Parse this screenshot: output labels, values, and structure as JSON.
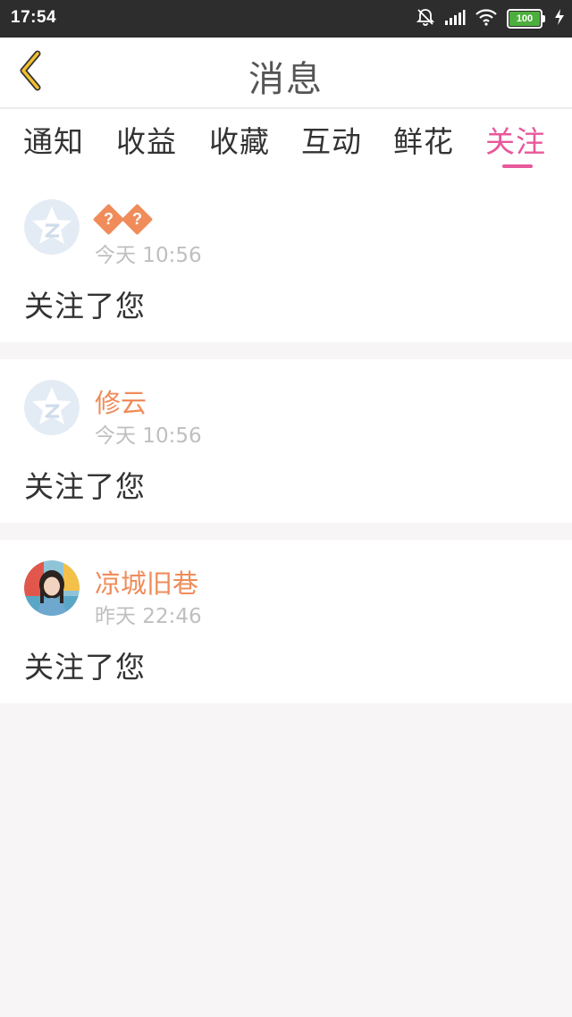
{
  "status_bar": {
    "time": "17:54",
    "battery": "100",
    "icons": [
      "mute-bell-icon",
      "signal-icon",
      "wifi-icon",
      "battery-icon",
      "charging-icon"
    ]
  },
  "header": {
    "title": "消息",
    "back_icon": "chevron-left-icon"
  },
  "tabs": [
    {
      "label": "通知",
      "active": false
    },
    {
      "label": "收益",
      "active": false
    },
    {
      "label": "收藏",
      "active": false
    },
    {
      "label": "互动",
      "active": false
    },
    {
      "label": "鲜花",
      "active": false
    },
    {
      "label": "关注",
      "active": true
    }
  ],
  "notifications": [
    {
      "username": "��",
      "time": "今天 10:56",
      "message": "关注了您",
      "avatar": "default-qzone-avatar"
    },
    {
      "username": "修云",
      "time": "今天 10:56",
      "message": "关注了您",
      "avatar": "default-qzone-avatar"
    },
    {
      "username": "凉城旧巷",
      "time": "昨天 22:46",
      "message": "关注了您",
      "avatar": "user-photo-avatar"
    }
  ],
  "colors": {
    "accent_pink": "#e8589b",
    "username_orange": "#f08c5a",
    "back_yellow": "#f2c02e",
    "status_bar_bg": "#2d2d2d",
    "page_bg": "#f8f5f6"
  }
}
